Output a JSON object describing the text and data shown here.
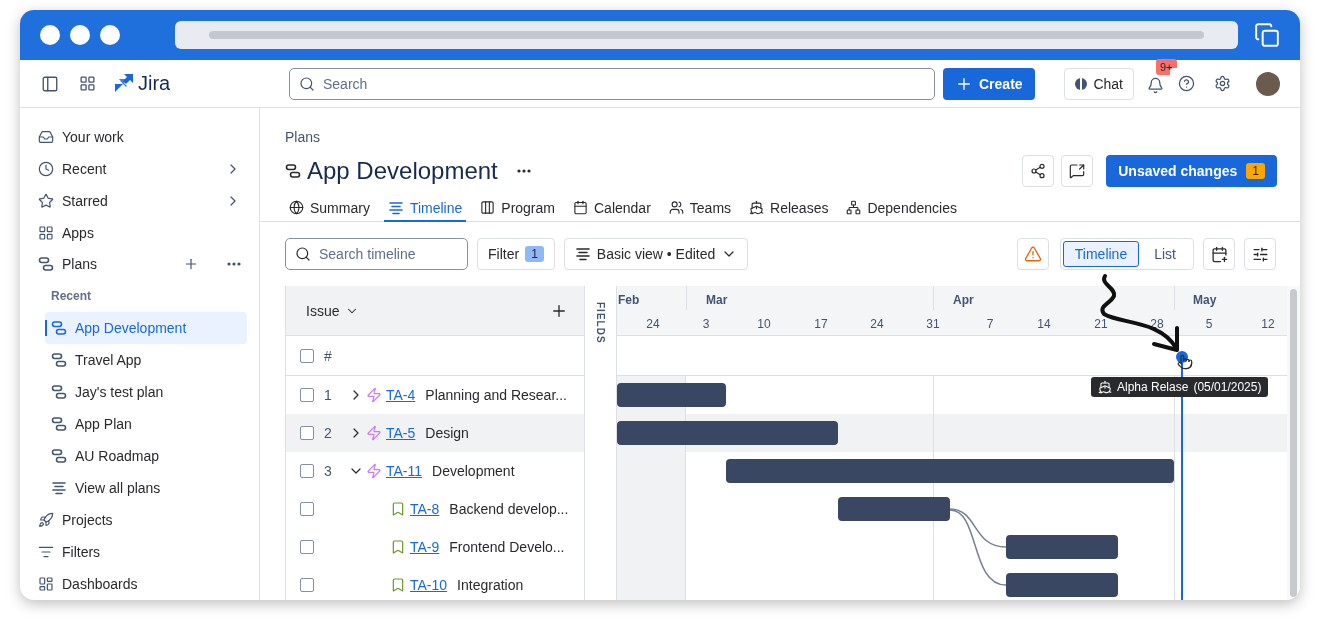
{
  "topbar": {
    "product": "Jira",
    "search": {
      "placeholder": "Search"
    },
    "create": "Create",
    "chat": "Chat",
    "notifications_badge": "9+"
  },
  "sidebar": {
    "items": [
      {
        "label": "Your work",
        "selected": false
      },
      {
        "label": "Recent",
        "selected": false,
        "submenu": true
      },
      {
        "label": "Starred",
        "selected": false,
        "submenu": true
      },
      {
        "label": "Apps",
        "selected": false
      },
      {
        "label": "Plans",
        "selected": false,
        "section": "Recent",
        "children": [
          {
            "label": "App Development",
            "selected": true
          },
          {
            "label": "Travel App",
            "selected": false
          },
          {
            "label": "Jay's test plan",
            "selected": false
          },
          {
            "label": "App Plan",
            "selected": false
          },
          {
            "label": "AU Roadmap",
            "selected": false
          },
          {
            "label": "View all plans",
            "selected": false
          }
        ]
      },
      {
        "label": "Projects",
        "selected": false
      },
      {
        "label": "Filters",
        "selected": false
      },
      {
        "label": "Dashboards",
        "selected": false
      }
    ]
  },
  "header": {
    "breadcrumb": "Plans",
    "title": "App Development",
    "unsaved": {
      "label": "Unsaved changes",
      "count": "1"
    }
  },
  "tabs": [
    {
      "label": "Summary",
      "selected": false
    },
    {
      "label": "Timeline",
      "selected": true
    },
    {
      "label": "Program",
      "selected": false
    },
    {
      "label": "Calendar",
      "selected": false
    },
    {
      "label": "Teams",
      "selected": false
    },
    {
      "label": "Releases",
      "selected": false
    },
    {
      "label": "Dependencies",
      "selected": false
    }
  ],
  "toolbar": {
    "search": {
      "placeholder": "Search timeline"
    },
    "filter": {
      "label": "Filter",
      "count": "1"
    },
    "view": "Basic view • Edited",
    "view_toggle": [
      {
        "label": "Timeline",
        "selected": true
      },
      {
        "label": "List",
        "selected": false
      }
    ]
  },
  "table": {
    "column": "Issue",
    "number_header": "#",
    "select_all_checked": false,
    "fields_label": "FIELDS",
    "rows": [
      {
        "number": "1",
        "key": "TA-4",
        "summary": "Planning and Resear...",
        "kind": "epic",
        "checked": false,
        "highlighted": false,
        "expandable": true,
        "expanded": false
      },
      {
        "number": "2",
        "key": "TA-5",
        "summary": "Design",
        "kind": "epic",
        "checked": false,
        "highlighted": true,
        "expandable": true,
        "expanded": false
      },
      {
        "number": "3",
        "key": "TA-11",
        "summary": "Development",
        "kind": "epic",
        "checked": false,
        "highlighted": false,
        "expandable": true,
        "expanded": true,
        "children": [
          {
            "key": "TA-8",
            "summary": "Backend develop...",
            "kind": "story",
            "checked": false,
            "highlighted": false,
            "expandable": false
          },
          {
            "key": "TA-9",
            "summary": "Frontend Develo...",
            "kind": "story",
            "checked": false,
            "highlighted": false,
            "expandable": false
          },
          {
            "key": "TA-10",
            "summary": "Integration",
            "kind": "story",
            "checked": false,
            "highlighted": false,
            "expandable": false
          }
        ]
      }
    ]
  },
  "timeline": {
    "months": [
      "Feb",
      "Mar",
      "Apr",
      "May"
    ],
    "days": [
      "24",
      "3",
      "10",
      "17",
      "24",
      "31",
      "7",
      "14",
      "21",
      "28",
      "5",
      "12"
    ],
    "milestone": {
      "label": "Alpha Relase",
      "date": "(05/01/2025)"
    }
  }
}
